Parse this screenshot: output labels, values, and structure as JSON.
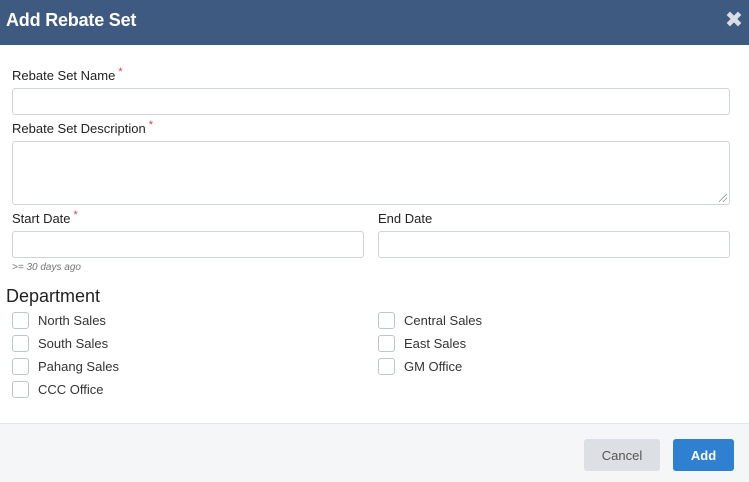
{
  "dialog": {
    "title": "Add Rebate Set",
    "close_icon": "close-icon"
  },
  "form": {
    "name_label": "Rebate Set Name",
    "name_value": "",
    "description_label": "Rebate Set Description",
    "description_value": "",
    "start_date_label": "Start Date",
    "start_date_value": "",
    "start_date_hint": ">= 30 days ago",
    "end_date_label": "End Date",
    "end_date_value": "",
    "required_marker": "*"
  },
  "department": {
    "title": "Department",
    "left": [
      {
        "label": "North Sales",
        "checked": false
      },
      {
        "label": "South Sales",
        "checked": false
      },
      {
        "label": "Pahang Sales",
        "checked": false
      },
      {
        "label": "CCC Office",
        "checked": false
      }
    ],
    "right": [
      {
        "label": "Central Sales",
        "checked": false
      },
      {
        "label": "East Sales",
        "checked": false
      },
      {
        "label": "GM Office",
        "checked": false
      }
    ]
  },
  "footer": {
    "cancel_label": "Cancel",
    "add_label": "Add"
  },
  "colors": {
    "header_bg": "#3e5a80",
    "primary_button": "#2f80d1",
    "required": "#e03b3b"
  }
}
